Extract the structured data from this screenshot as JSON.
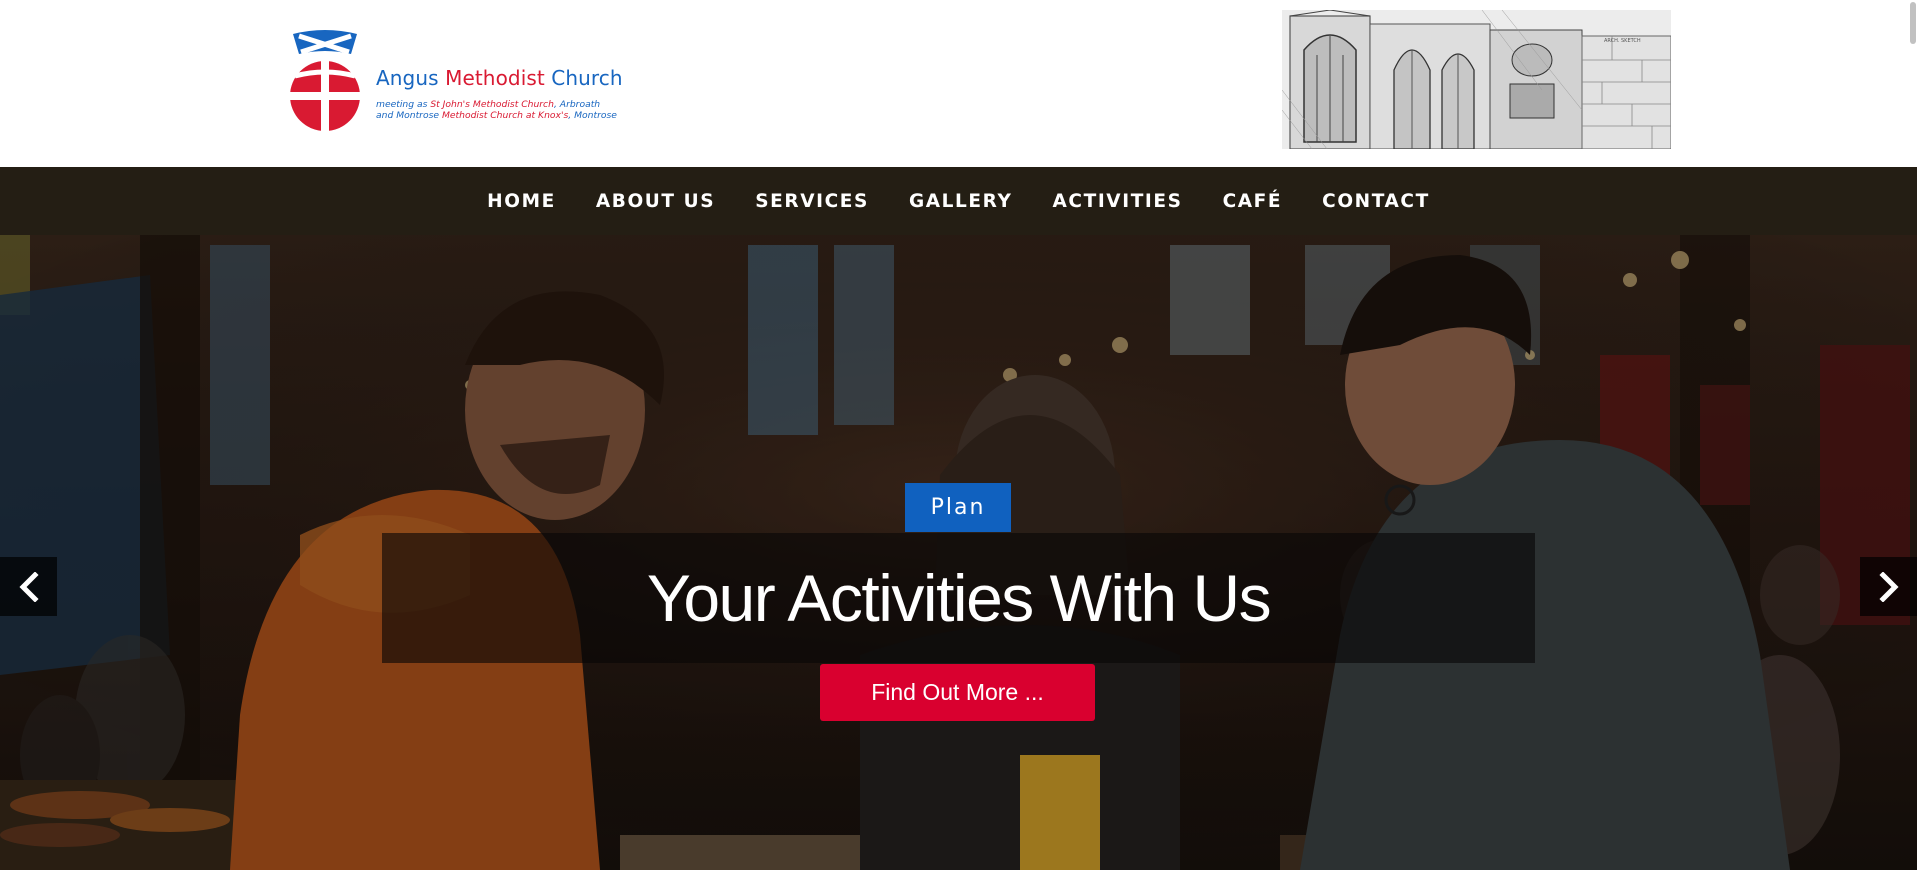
{
  "header": {
    "logo": {
      "title_part1": "Angus ",
      "title_part2": "Methodist",
      "title_part3": " Church",
      "sub_line1_a": "meeting as ",
      "sub_line1_b": "St John's Methodist Church",
      "sub_line1_c": ", Arbroath",
      "sub_line2_a": "and Montrose ",
      "sub_line2_b": "Methodist Church at Knox's",
      "sub_line2_c": ", Montrose"
    },
    "sketch_caption": "ARCH. SKETCH"
  },
  "nav": {
    "items": [
      "HOME",
      "ABOUT US",
      "SERVICES",
      "GALLERY",
      "ACTIVITIES",
      "CAFÉ",
      "CONTACT"
    ]
  },
  "hero": {
    "badge": "Plan",
    "headline": "Your Activities With Us",
    "cta": "Find Out More ..."
  },
  "colors": {
    "brand_blue": "#1866c0",
    "brand_red": "#d91a32",
    "nav_bg": "#241e14",
    "badge_bg": "#1061bf",
    "cta_bg": "#d9002f"
  },
  "icons": {
    "prev": "chevron-left-icon",
    "next": "chevron-right-icon"
  }
}
